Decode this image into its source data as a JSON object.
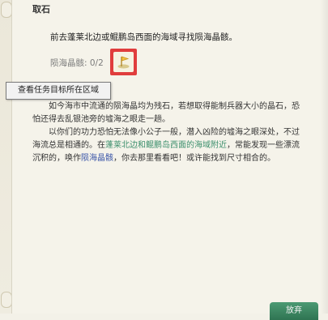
{
  "quest": {
    "title": "取石",
    "objective": "前去蓬莱北边或鲲鹏岛西面的海域寻找陨海晶骸。",
    "counter_label": "陨海晶骸: 0/2",
    "tooltip": "查看任务目标所在区域"
  },
  "description": {
    "line1": "如今海市中流通的陨海晶均为残石，若想取得能制兵器大小的晶石，恐",
    "line2": "怕还得去乱银池旁的墟海之眼走一趟。",
    "line3": "以你们的功力恐怕无法像小公子一般，潜入凶险的墟海之眼深处，不过",
    "line4_pre": "海流总是相通的。在",
    "line4_link": "蓬莱北边和鲲鹏岛西面的海域附近",
    "line4_post": "，常能发现一些漂流",
    "line5_pre": "沉积的，唤作",
    "line5_item": "陨海晶骸",
    "line5_post": "，你去那里看看吧！或许能找到尺寸相合的。"
  },
  "buttons": {
    "abandon": "放弃"
  },
  "colors": {
    "highlight_red": "#e03d3d",
    "link_green": "#3c8f6c",
    "item_blue": "#3a55a8",
    "button_green": "#2f7452"
  },
  "icons": {
    "flag": "flag-icon"
  }
}
